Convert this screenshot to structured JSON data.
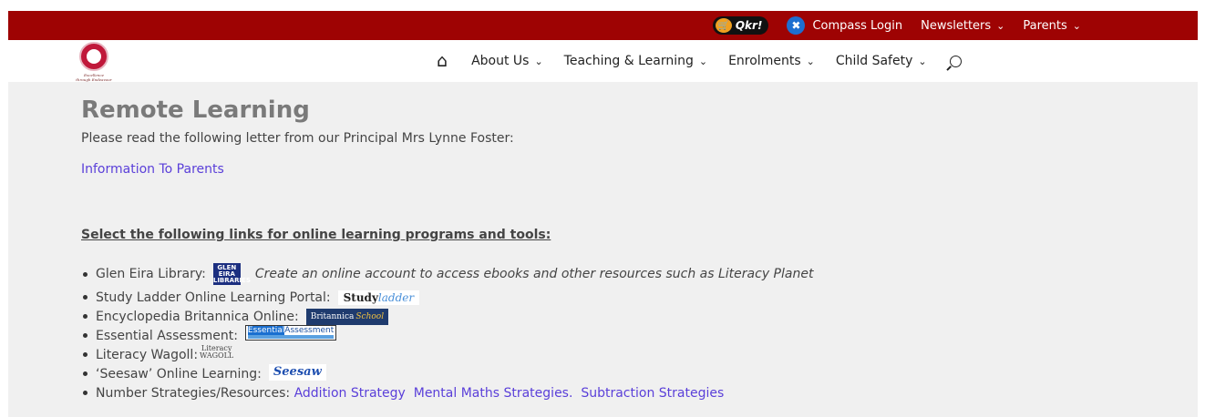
{
  "topbar": {
    "qkr_label": "Qkr!",
    "compass_label": "Compass Login",
    "newsletters_label": "Newsletters",
    "parents_label": "Parents",
    "bg_color": "#9e0303"
  },
  "header": {
    "nav": [
      "About Us",
      "Teaching & Learning",
      "Enrolments",
      "Child Safety"
    ]
  },
  "main": {
    "title": "Remote Learning",
    "intro": "Please read the following letter from our Principal Mrs Lynne Foster:",
    "info_link": "Information To Parents",
    "section_heading": "Select the following links for online learning programs and tools:",
    "items": [
      {
        "label": "Glen Eira Library:",
        "description": "Create an online account to access ebooks and other resources such as Literacy Planet"
      },
      {
        "label": "Study Ladder Online Learning Portal:"
      },
      {
        "label": "Encyclopedia Britannica Online:"
      },
      {
        "label": "Essential Assessment:"
      },
      {
        "label": "Literacy Wagoll:"
      },
      {
        "label": "‘Seesaw’ Online Learning:"
      },
      {
        "label": "Number Strategies/Resources:",
        "links": [
          "Addition Strategy",
          "Mental Maths Strategies.",
          "Subtraction Strategies"
        ]
      }
    ]
  }
}
